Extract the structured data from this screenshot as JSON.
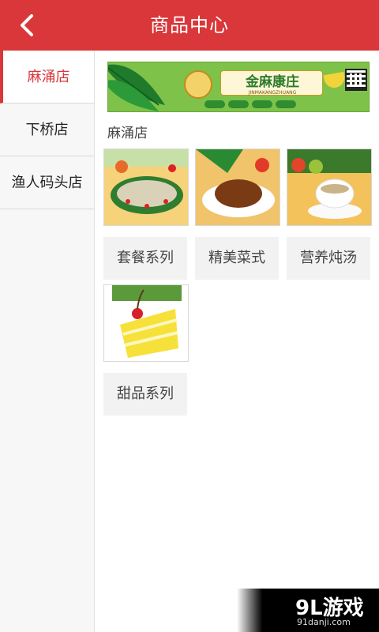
{
  "header": {
    "title": "商品中心"
  },
  "sidebar": {
    "items": [
      {
        "label": "麻涌店"
      },
      {
        "label": "下桥店"
      },
      {
        "label": "渔人码头店"
      }
    ]
  },
  "banner": {
    "brand": "金麻康庄",
    "pinyin": "JINMAKANGZHUANG"
  },
  "store": {
    "title": "麻涌店"
  },
  "categories": [
    {
      "label": "套餐系列"
    },
    {
      "label": "精美菜式"
    },
    {
      "label": "营养炖汤"
    },
    {
      "label": "甜品系列"
    }
  ],
  "watermark": {
    "main": "9L游戏",
    "sub": "91danji.com"
  }
}
